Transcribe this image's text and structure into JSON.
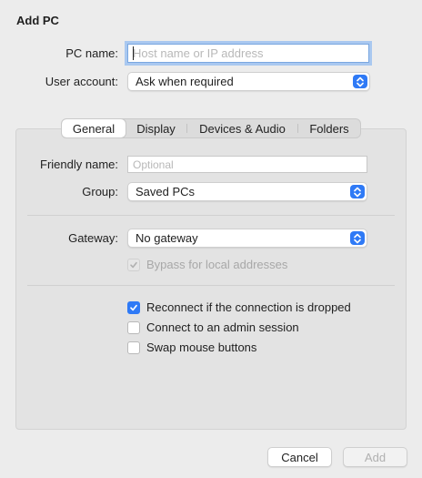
{
  "dialog": {
    "title": "Add PC"
  },
  "pc_name": {
    "label": "PC name:",
    "placeholder": "Host name or IP address",
    "value": ""
  },
  "user_account": {
    "label": "User account:",
    "selected": "Ask when required"
  },
  "tabs": [
    {
      "label": "General",
      "active": true
    },
    {
      "label": "Display",
      "active": false
    },
    {
      "label": "Devices & Audio",
      "active": false
    },
    {
      "label": "Folders",
      "active": false
    }
  ],
  "general": {
    "friendly_name": {
      "label": "Friendly name:",
      "placeholder": "Optional",
      "value": ""
    },
    "group": {
      "label": "Group:",
      "selected": "Saved PCs"
    },
    "gateway": {
      "label": "Gateway:",
      "selected": "No gateway"
    },
    "bypass": {
      "label": "Bypass for local addresses",
      "checked": true,
      "enabled": false
    },
    "reconnect": {
      "label": "Reconnect if the connection is dropped",
      "checked": true
    },
    "admin_session": {
      "label": "Connect to an admin session",
      "checked": false
    },
    "swap_mouse": {
      "label": "Swap mouse buttons",
      "checked": false
    }
  },
  "buttons": {
    "cancel": "Cancel",
    "add": "Add"
  },
  "colors": {
    "accent": "#2f7af6",
    "focus_ring": "#a9c8f0"
  }
}
